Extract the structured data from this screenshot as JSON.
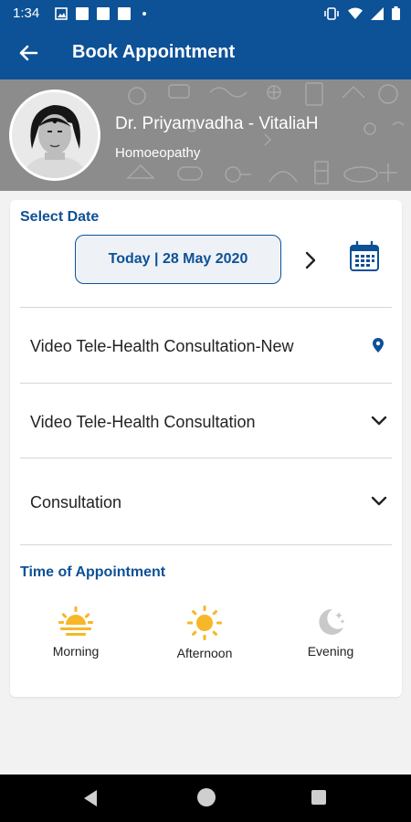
{
  "status_bar": {
    "time": "1:34"
  },
  "header": {
    "title": "Book Appointment"
  },
  "doctor": {
    "name": "Dr. Priyamvadha - VitaliaH",
    "specialty": "Homoeopathy"
  },
  "booking": {
    "select_date_label": "Select Date",
    "selected_date": "Today | 28 May 2020",
    "consultation_types": [
      {
        "label": "Video Tele-Health Consultation-New",
        "icon": "location-pin-icon"
      },
      {
        "label": "Video Tele-Health Consultation",
        "icon": "chevron-down-icon"
      },
      {
        "label": "Consultation",
        "icon": "chevron-down-icon"
      }
    ],
    "time_label": "Time of Appointment",
    "time_slots": [
      {
        "label": "Morning",
        "icon": "sunrise-icon",
        "enabled": true
      },
      {
        "label": "Afternoon",
        "icon": "sun-icon",
        "enabled": true
      },
      {
        "label": "Evening",
        "icon": "moon-icon",
        "enabled": false
      }
    ]
  },
  "colors": {
    "primary": "#0d5196",
    "sun": "#f6b728",
    "disabled": "#c9c9c9"
  }
}
